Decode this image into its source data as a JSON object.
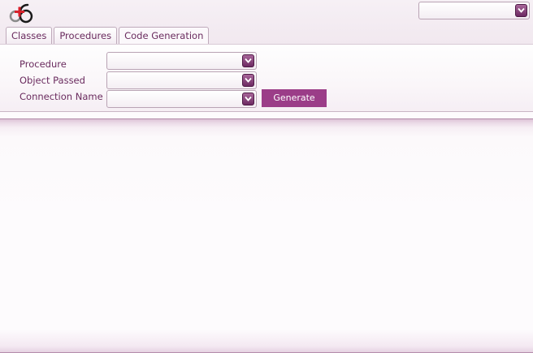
{
  "header": {
    "logo": "app-logo",
    "top_select_value": ""
  },
  "tabs": [
    {
      "label": "Classes"
    },
    {
      "label": "Procedures"
    },
    {
      "label": "Code Generation",
      "active": true
    }
  ],
  "form": {
    "procedure_label": "Procedure",
    "procedure_value": "",
    "object_passed_label": "Object Passed",
    "object_passed_value": "",
    "connection_name_label": "Connection Name",
    "connection_name_value": "",
    "generate_label": "Generate"
  },
  "colors": {
    "accent": "#9b3d88",
    "text": "#6a2b5e",
    "arrow_button": "#7d3570"
  },
  "icons": {
    "dropdown": "chevron-down-icon",
    "logo": "logo-icon"
  }
}
